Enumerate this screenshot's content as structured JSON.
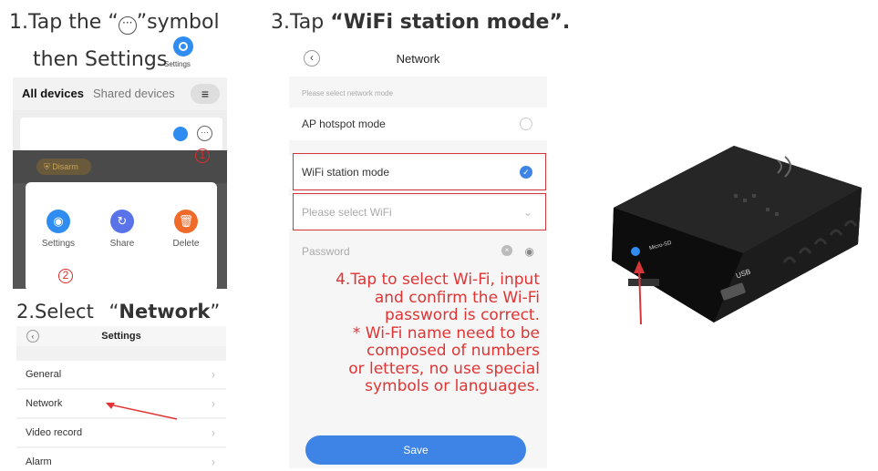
{
  "step1": {
    "line1_before": "1.Tap the “",
    "line1_after": "”symbol",
    "line2": "then Settings",
    "settings_icon_label": "Settings",
    "screen": {
      "tab_all": "All devices",
      "tab_shared": "Shared devices",
      "disarm": "Disarm",
      "marker_1": "1",
      "marker_2": "2",
      "actions": [
        {
          "label": "Settings",
          "color": "#2f8cf0"
        },
        {
          "label": "Share",
          "color": "#5a73e8"
        },
        {
          "label": "Delete",
          "color": "#f06a2a"
        }
      ]
    }
  },
  "step2": {
    "prefix": "2.Select ",
    "quote_open": "“",
    "bold": "Network",
    "quote_close": "”",
    "screen": {
      "title": "Settings",
      "rows": [
        "General",
        "Network",
        "Video record",
        "Alarm"
      ]
    }
  },
  "step3": {
    "prefix": "3.Tap ",
    "bold": "“WiFi station mode”.",
    "screen": {
      "title": "Network",
      "section": "Please select network mode",
      "ap_mode": "AP hotspot mode",
      "wifi_mode": "WiFi station mode",
      "select_wifi": "Please select WiFi",
      "password": "Password",
      "save": "Save"
    }
  },
  "step4_note": "4.Tap to select Wi-Fi, input\nand confirm the Wi-Fi\npassword is correct.\n* Wi-Fi name need to be\ncomposed of numbers\nor letters, no use special\nsymbols or languages.",
  "device": {
    "label_sd": "Micro-SD",
    "label_usb": "USB"
  },
  "colors": {
    "accent_blue": "#2f8cf0",
    "highlight_red": "#d7373a",
    "note_red": "#e03434"
  }
}
